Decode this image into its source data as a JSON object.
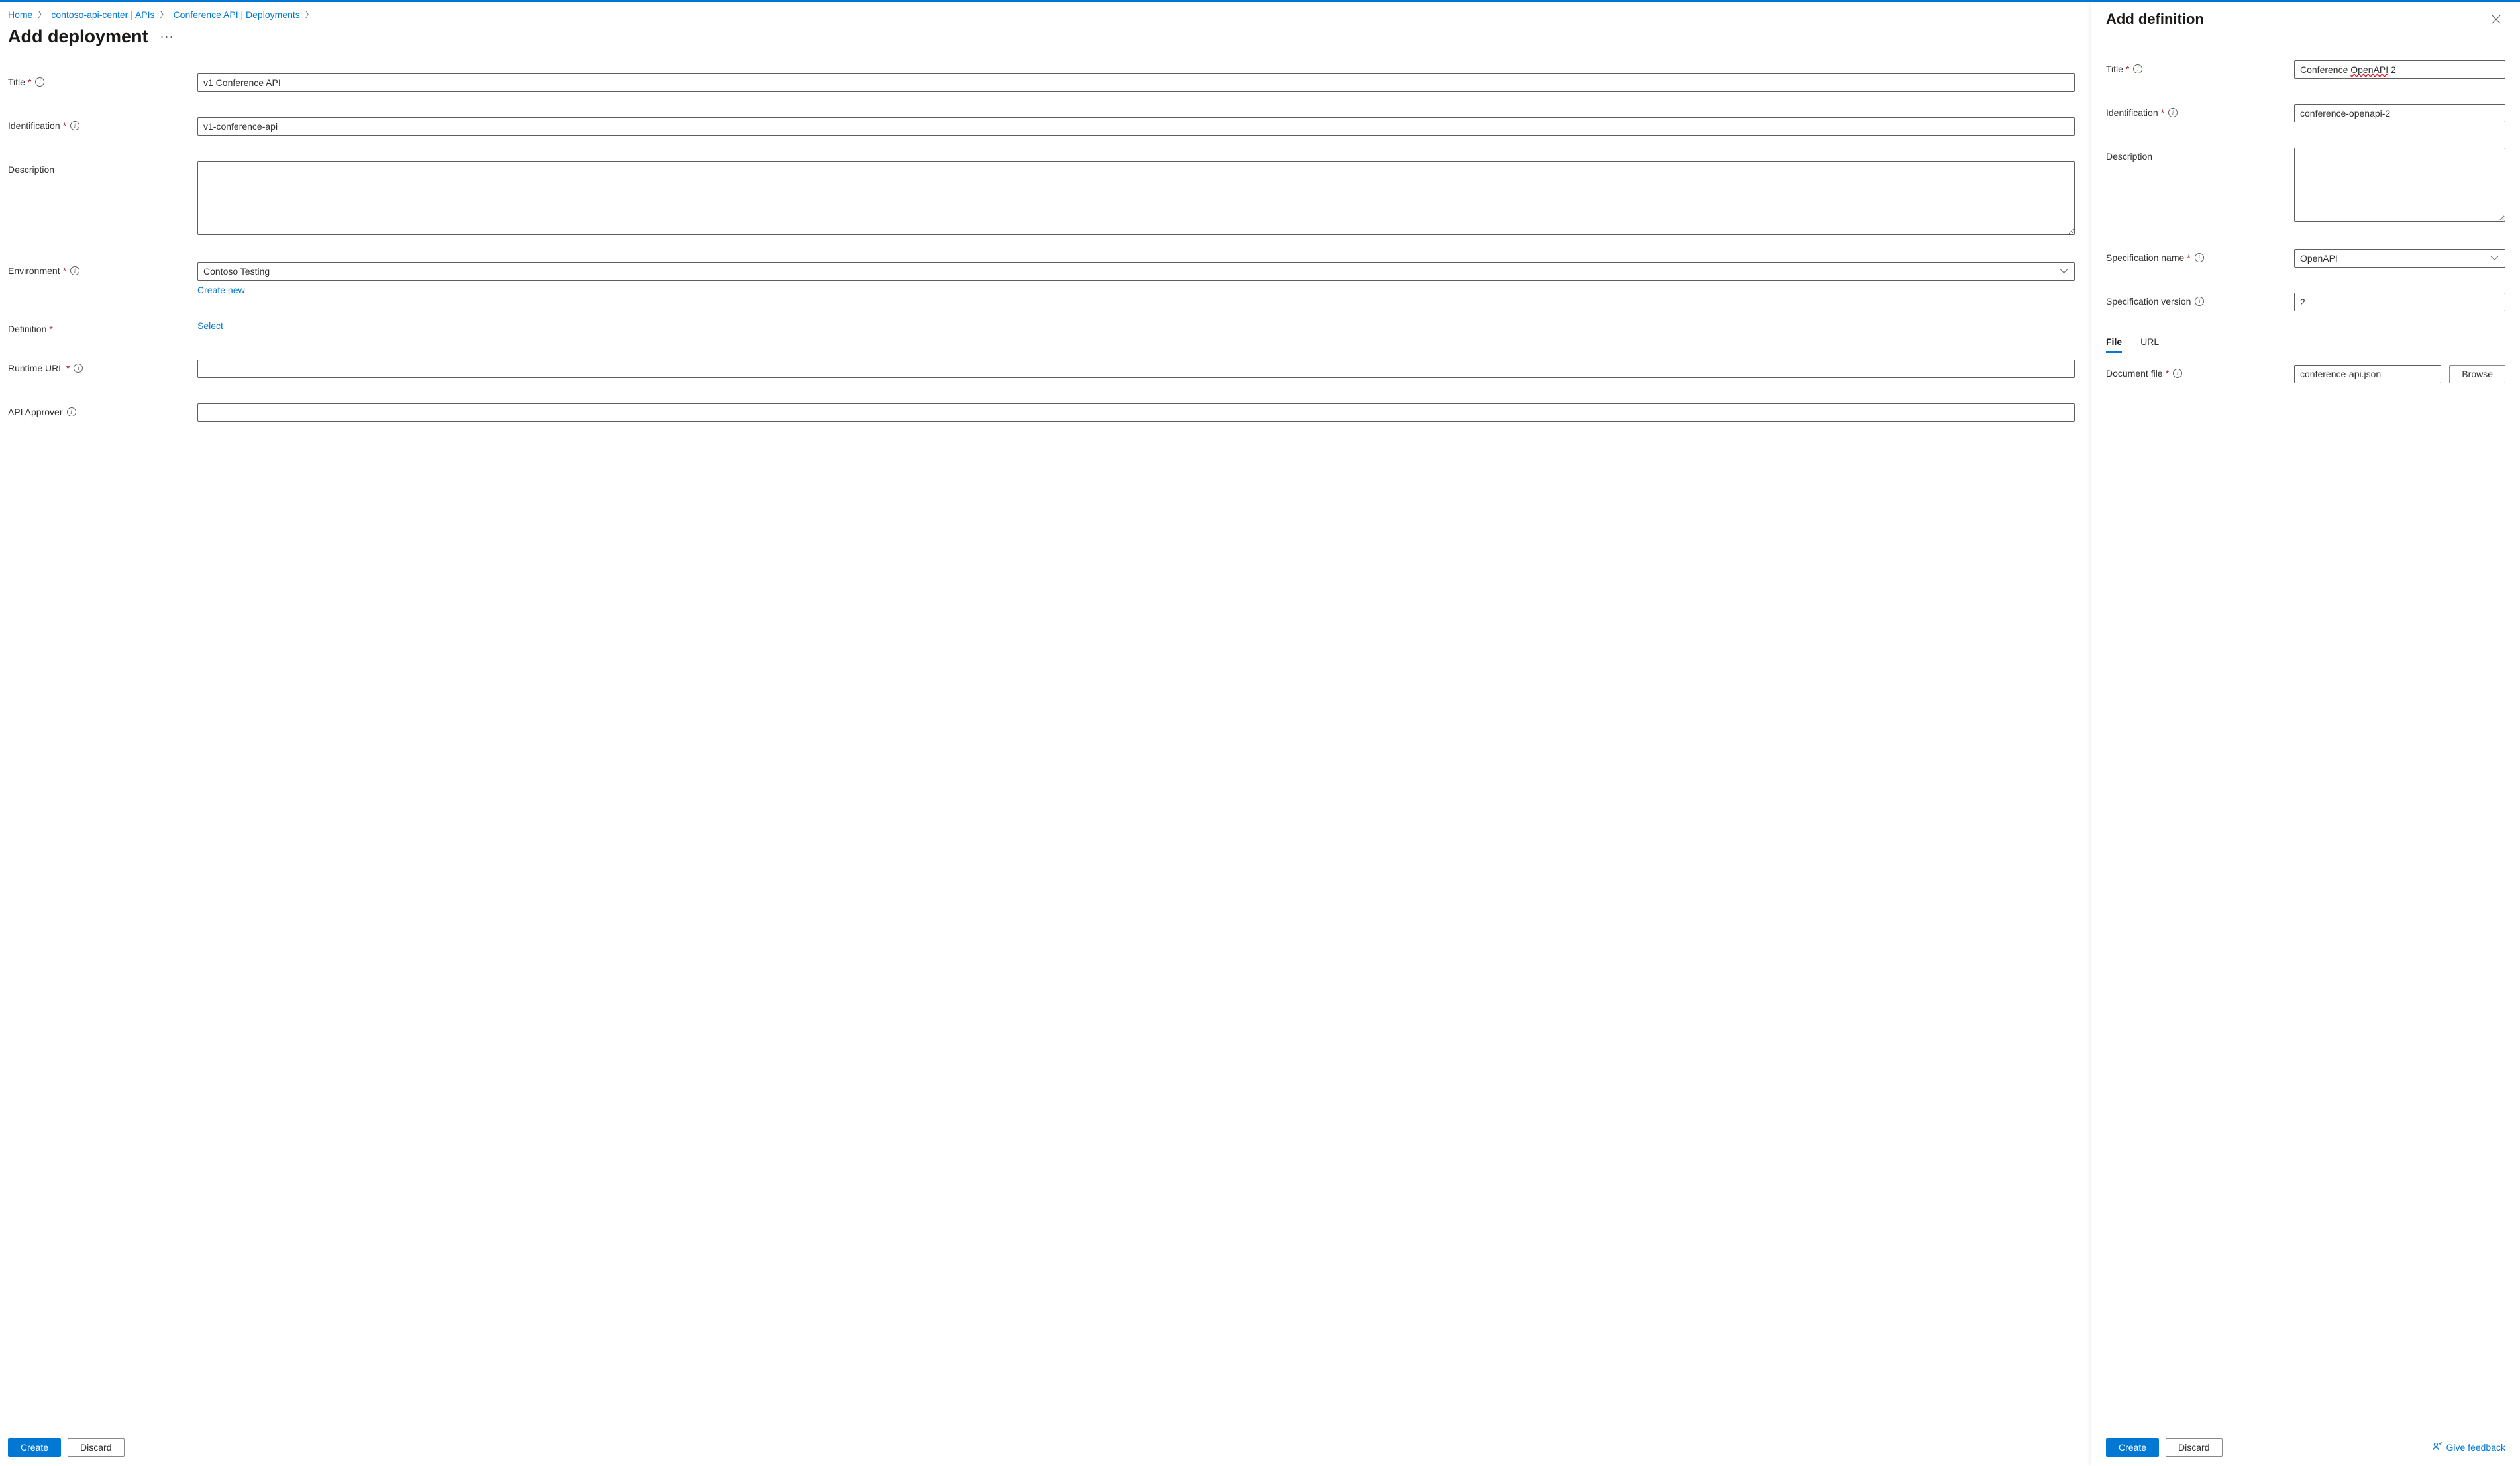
{
  "breadcrumb": {
    "items": [
      {
        "label": "Home"
      },
      {
        "label": "contoso-api-center | APIs"
      },
      {
        "label": "Conference API | Deployments"
      }
    ]
  },
  "main": {
    "title": "Add deployment",
    "fields": {
      "title": {
        "label": "Title",
        "value": "v1 Conference API"
      },
      "identification": {
        "label": "Identification",
        "value": "v1-conference-api"
      },
      "description": {
        "label": "Description",
        "value": ""
      },
      "environment": {
        "label": "Environment",
        "value": "Contoso Testing",
        "helper": "Create new"
      },
      "definition": {
        "label": "Definition",
        "action": "Select"
      },
      "runtimeUrl": {
        "label": "Runtime URL",
        "value": ""
      },
      "apiApprover": {
        "label": "API Approver",
        "value": ""
      }
    },
    "buttons": {
      "create": "Create",
      "discard": "Discard"
    }
  },
  "side": {
    "title": "Add definition",
    "fields": {
      "title": {
        "label": "Title",
        "value_pre": "Conference ",
        "value_spell": "OpenAPI",
        "value_post": " 2"
      },
      "identification": {
        "label": "Identification",
        "value": "conference-openapi-2"
      },
      "description": {
        "label": "Description",
        "value": ""
      },
      "specName": {
        "label": "Specification name",
        "value": "OpenAPI"
      },
      "specVersion": {
        "label": "Specification version",
        "value": "2"
      },
      "tabs": {
        "file": "File",
        "url": "URL"
      },
      "documentFile": {
        "label": "Document file",
        "value": "conference-api.json",
        "browse": "Browse"
      }
    },
    "buttons": {
      "create": "Create",
      "discard": "Discard"
    },
    "feedback": "Give feedback"
  }
}
